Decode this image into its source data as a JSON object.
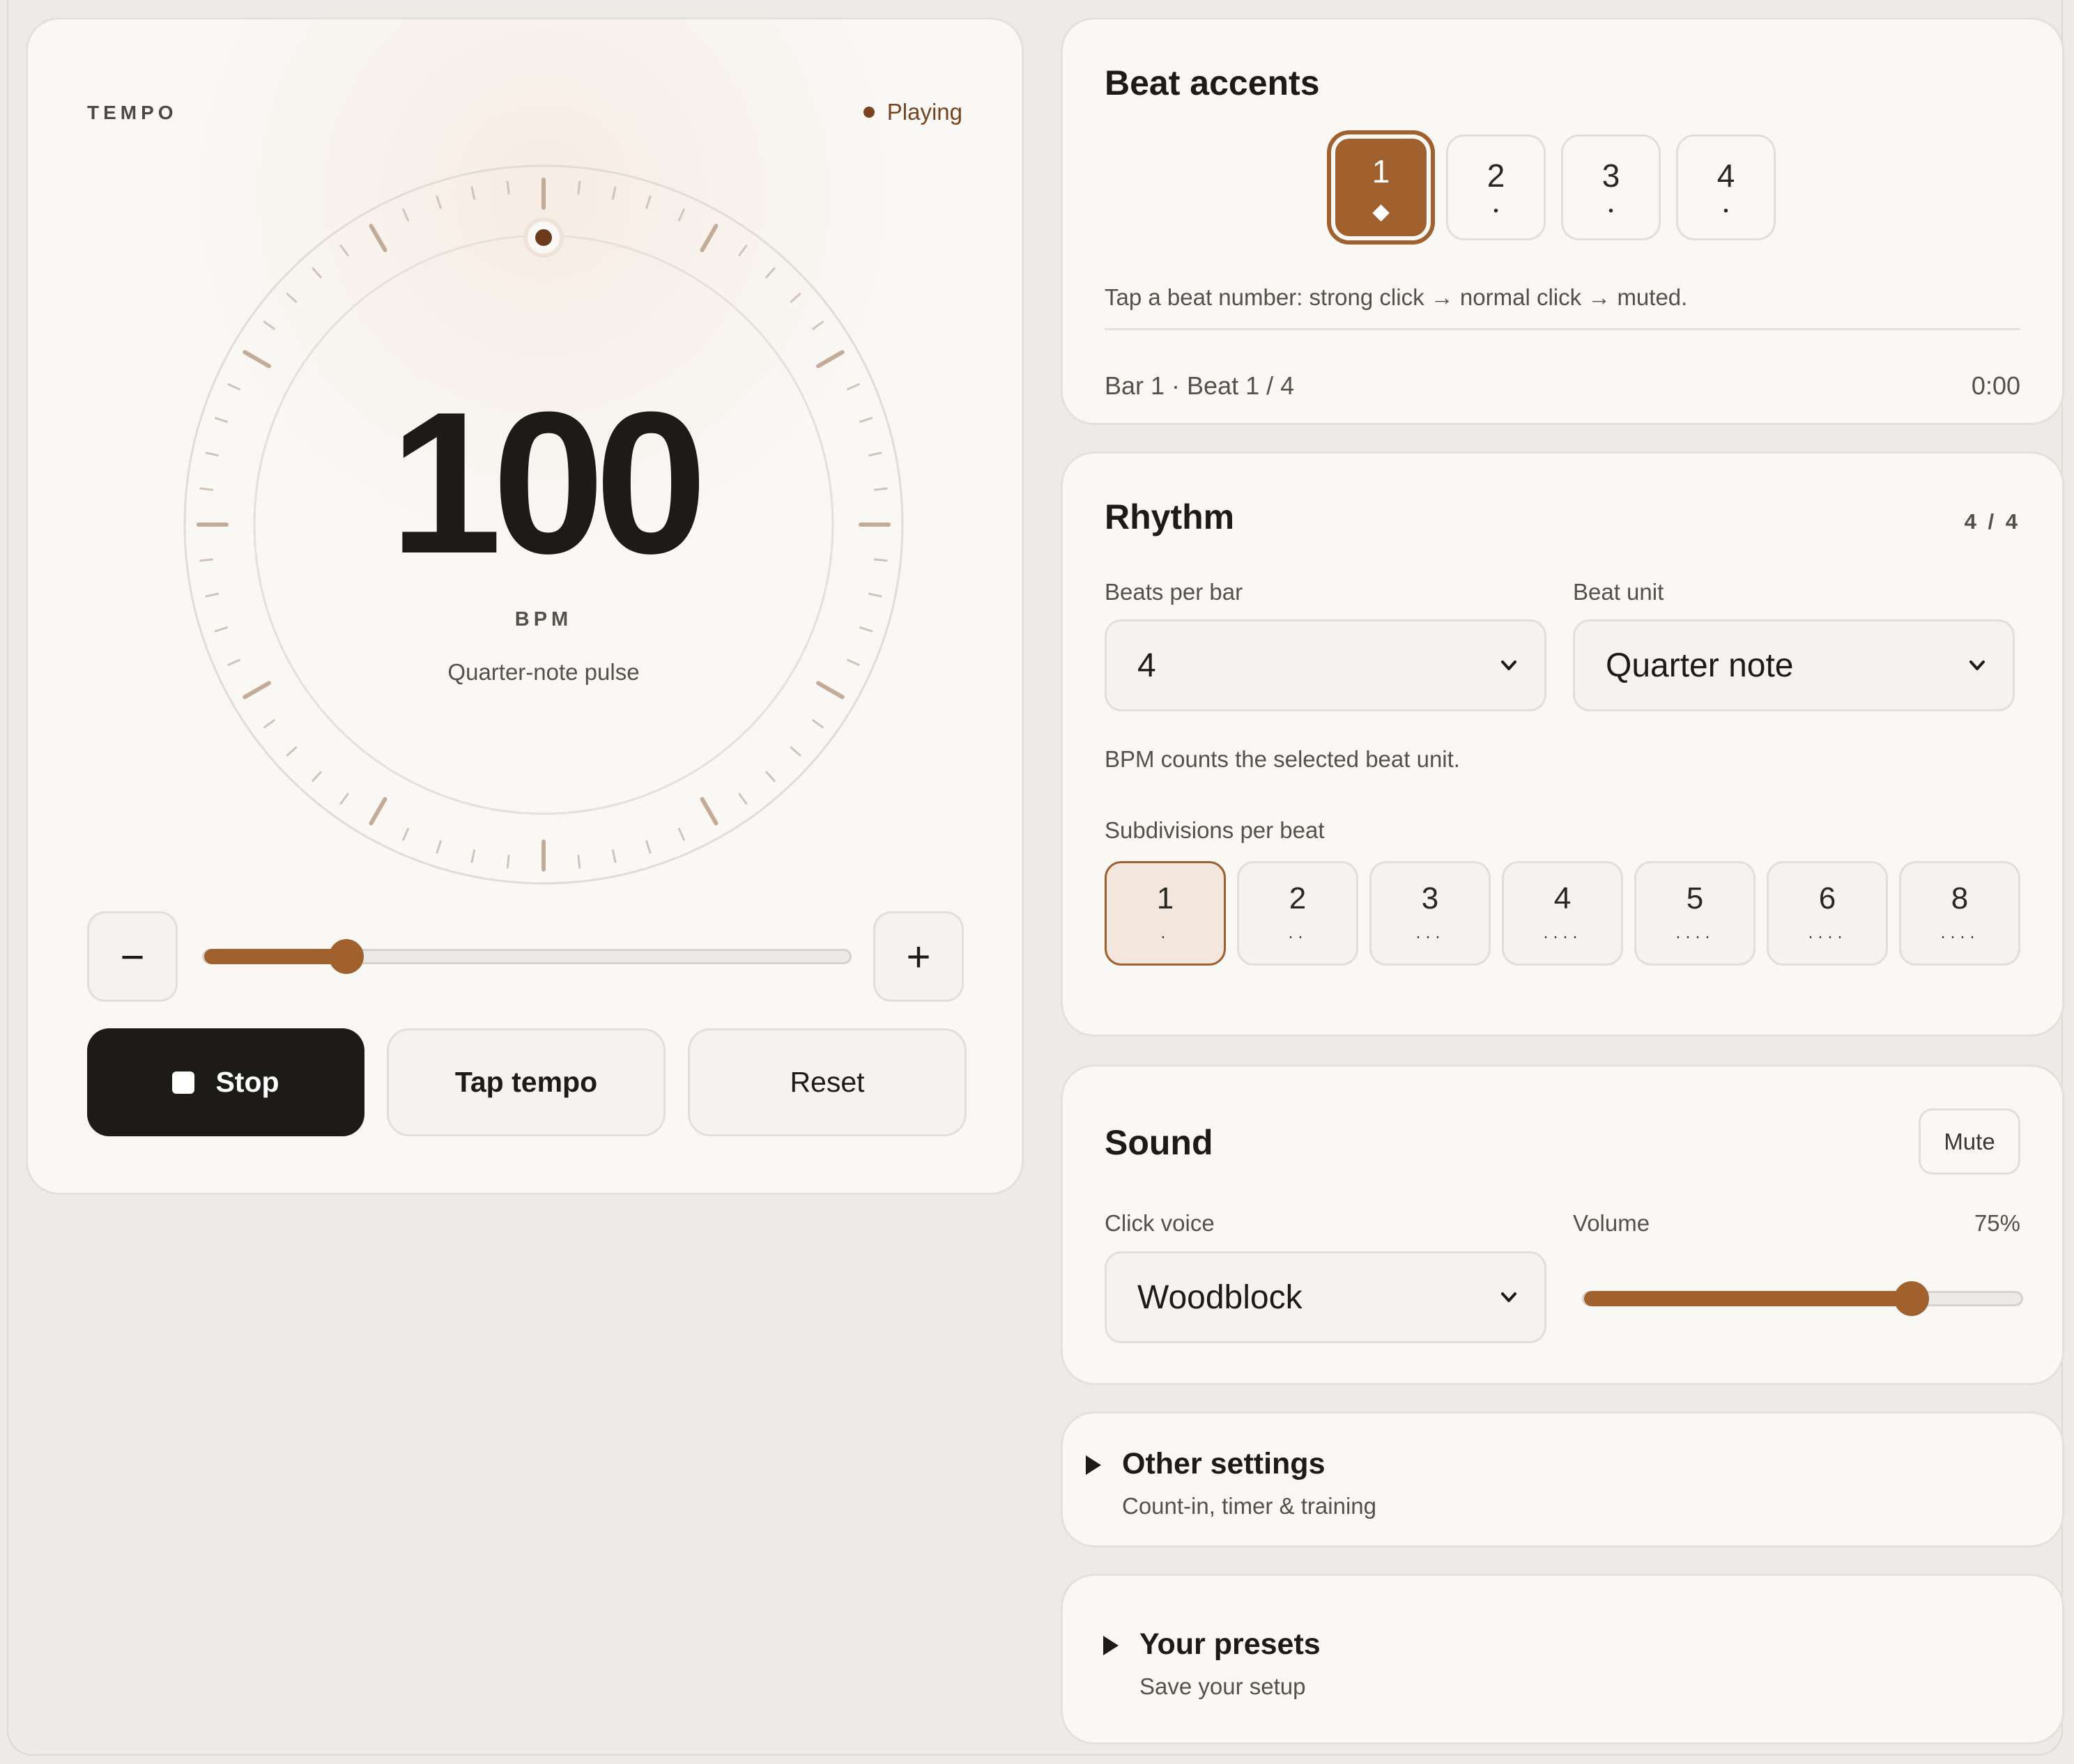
{
  "tempo": {
    "eyebrow": "TEMPO",
    "status": "Playing",
    "bpm": "100",
    "bpm_unit": "BPM",
    "pulse_desc": "Quarter-note pulse",
    "minus_label": "−",
    "plus_label": "+",
    "slider_fraction": 0.22,
    "stop_label": "Stop",
    "tap_label": "Tap tempo",
    "reset_label": "Reset"
  },
  "accents": {
    "title": "Beat accents",
    "beats": [
      {
        "label": "1",
        "mark": "◆",
        "state": "strong"
      },
      {
        "label": "2",
        "mark": "•",
        "state": "normal"
      },
      {
        "label": "3",
        "mark": "•",
        "state": "normal"
      },
      {
        "label": "4",
        "mark": "•",
        "state": "normal"
      }
    ],
    "hint": "Tap a beat number: strong click → normal click → muted.",
    "bar_info": "Bar 1 · Beat 1 / 4",
    "timer": "0:00"
  },
  "rhythm": {
    "title": "Rhythm",
    "meter": "4 / 4",
    "beats_label": "Beats per bar",
    "beats_value": "4",
    "unit_label": "Beat unit",
    "unit_value": "Quarter note",
    "note": "BPM counts the selected beat unit.",
    "sub_label": "Subdivisions per beat",
    "subdivisions": [
      {
        "label": "1",
        "dots": "·"
      },
      {
        "label": "2",
        "dots": "··"
      },
      {
        "label": "3",
        "dots": "···"
      },
      {
        "label": "4",
        "dots": "····"
      },
      {
        "label": "5",
        "dots": "····"
      },
      {
        "label": "6",
        "dots": "····"
      },
      {
        "label": "8",
        "dots": "····"
      }
    ]
  },
  "sound": {
    "title": "Sound",
    "mute_label": "Mute",
    "voice_label": "Click voice",
    "voice_value": "Woodblock",
    "volume_label": "Volume",
    "volume_pct": "75%",
    "volume_fraction": 0.75
  },
  "other": {
    "title": "Other settings",
    "subtitle": "Count-in, timer & training"
  },
  "presets": {
    "title": "Your presets",
    "subtitle": "Save your setup"
  },
  "colors": {
    "accent": "#a0612f",
    "text": "#1d1b18",
    "stop_bg": "#1d1b18",
    "card_bg": "#f9f8f5",
    "page_bg": "#edebe7"
  },
  "icons": {
    "stop": "stop-square-icon",
    "chevron": "chevron-down-icon",
    "disclosure": "triangle-right-icon"
  }
}
